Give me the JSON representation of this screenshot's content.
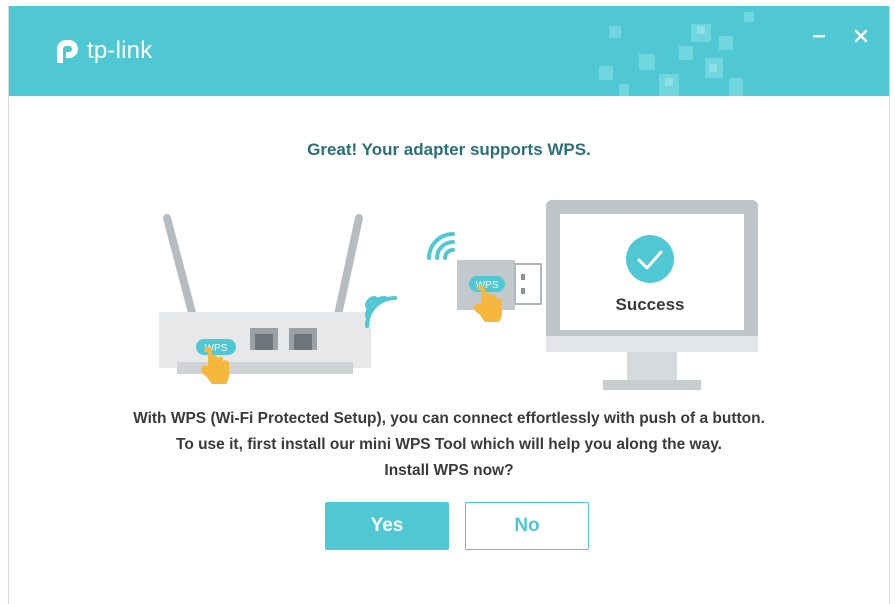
{
  "header": {
    "logo_text": "tp-link",
    "minimize_icon": "minimize-icon",
    "close_icon": "close-icon"
  },
  "main": {
    "heading": "Great! Your adapter supports WPS.",
    "router_wps_label": "WPS",
    "adapter_wps_label": "WPS",
    "monitor_status": "Success",
    "description_lines": [
      "With WPS (Wi-Fi Protected Setup), you can connect effortlessly with push of a button.",
      "To use it, first install our mini WPS Tool which will help you along the way.",
      "Install WPS now?"
    ]
  },
  "buttons": {
    "yes_label": "Yes",
    "no_label": "No"
  },
  "colors": {
    "accent": "#4fc8d4",
    "heading": "#2b6f78",
    "text": "#3a3a3a"
  }
}
